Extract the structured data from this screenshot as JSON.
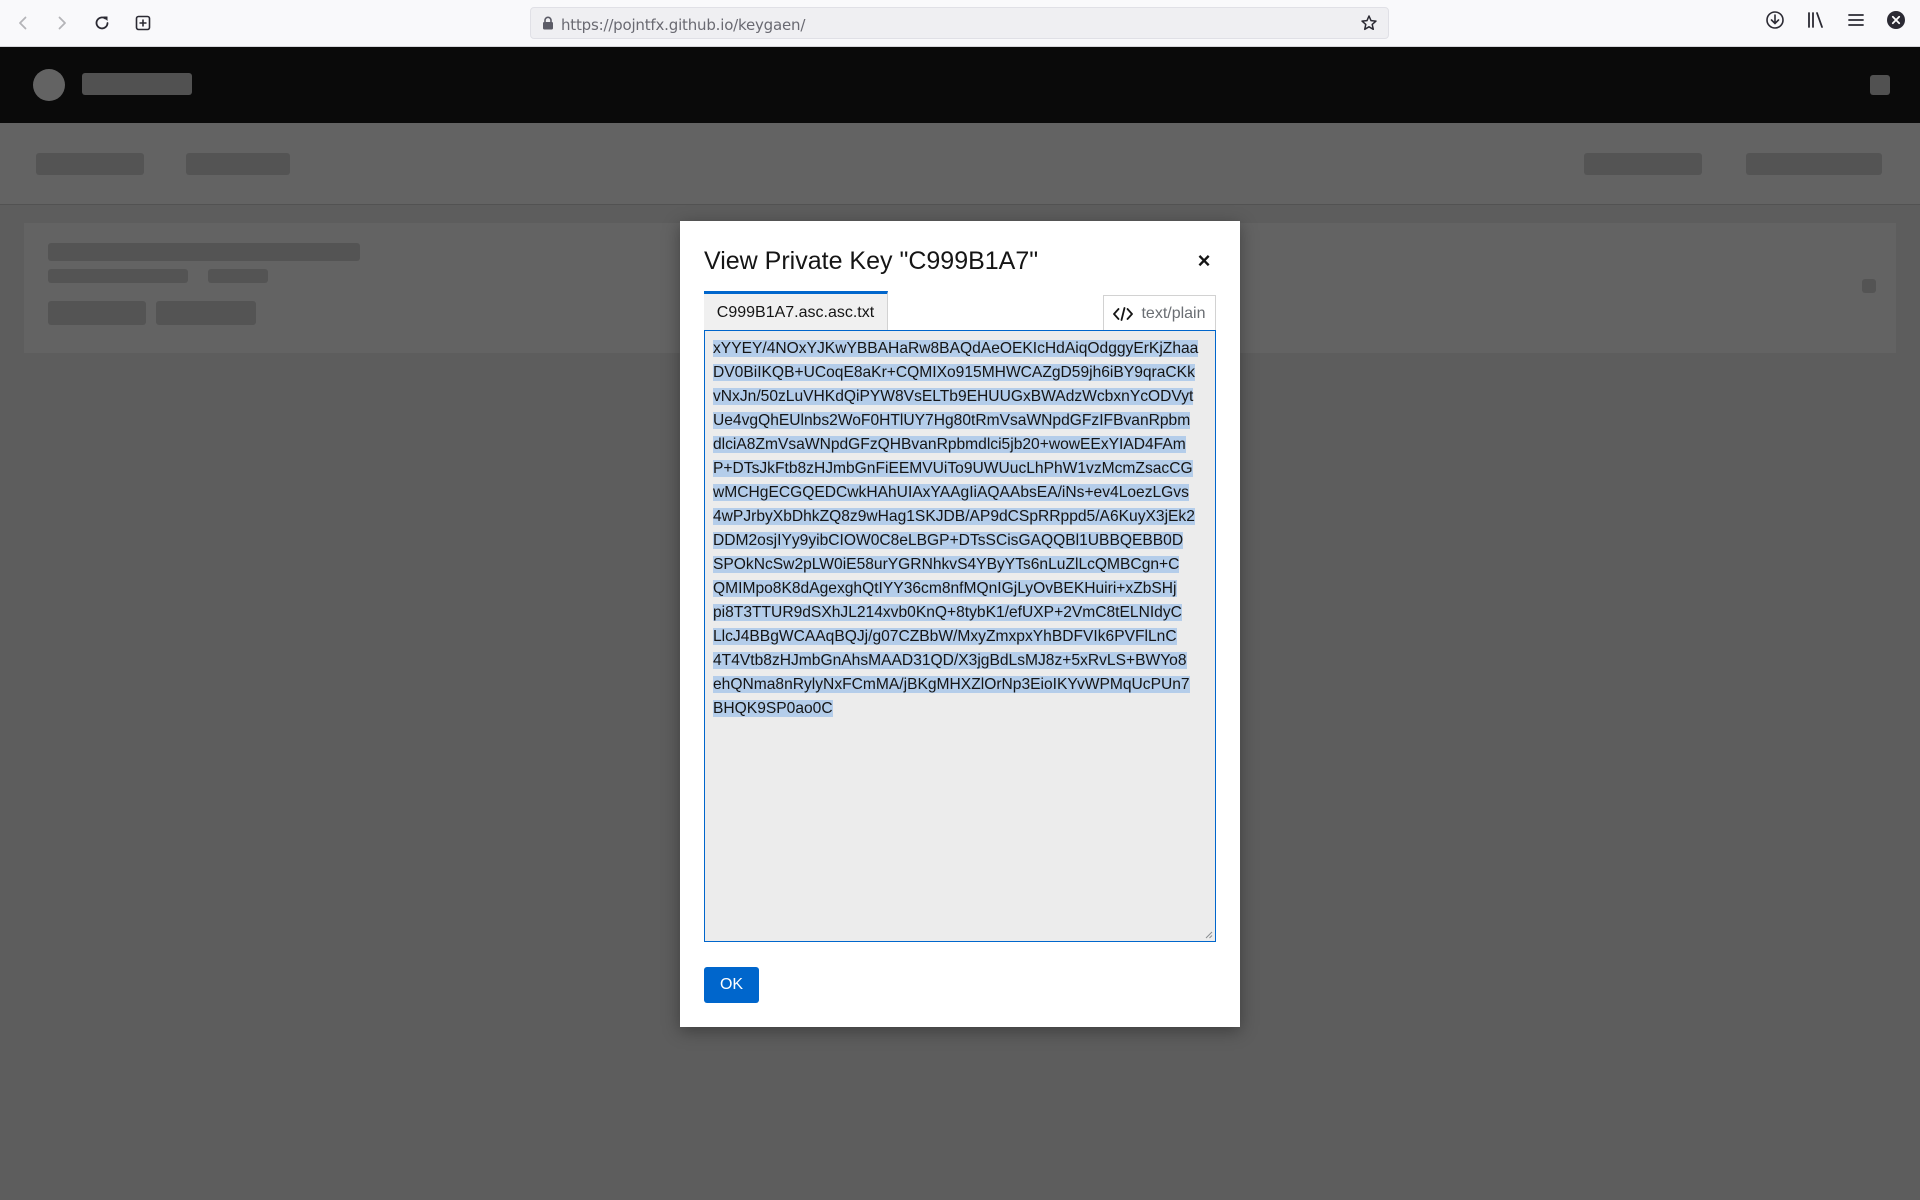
{
  "browser": {
    "url_host": "https://pojntfx.github.io",
    "url_path": "/keygaen/",
    "icons": [
      "back-icon",
      "forward-icon",
      "reload-icon",
      "new-tab-icon",
      "lock-icon",
      "star-icon",
      "download-icon",
      "library-icon",
      "menu-icon",
      "close-icon"
    ]
  },
  "modal": {
    "title": "View Private Key \"C999B1A7\"",
    "close_symbol": "×",
    "file_tab_label": "C999B1A7.asc.asc.txt",
    "mime_label": "text/plain",
    "ok_label": "OK",
    "key_lines": [
      "xYYEY/4NOxYJKwYBBAHaRw8BAQdAeOEKIcHdAiqOdggyErKjZhaa",
      "DV0BiIKQB+UCoqE8aKr+CQMIXo915MHWCAZgD59jh6iBY9qraCKk",
      "vNxJn/50zLuVHKdQiPYW8VsELTb9EHUUGxBWAdzWcbxnYcODVyt",
      "Ue4vgQhEUlnbs2WoF0HTlUY7Hg80tRmVsaWNpdGFzIFBvanRpbm",
      "dlciA8ZmVsaWNpdGFzQHBvanRpbmdlci5jb20+wowEExYIAD4FAm",
      "P+DTsJkFtb8zHJmbGnFiEEMVUiTo9UWUucLhPhW1vzMcmZsacCG",
      "wMCHgECGQEDCwkHAhUIAxYAAgIiAQAAbsEA/iNs+ev4LoezLGvs",
      "4wPJrbyXbDhkZQ8z9wHag1SKJDB/AP9dCSpRRppd5/A6KuyX3jEk2",
      "DDM2osjIYy9yibCIOW0C8eLBGP+DTsSCisGAQQBl1UBBQEBB0D",
      "SPOkNcSw2pLW0iE58urYGRNhkvS4YByYTs6nLuZlLcQMBCgn+C",
      "QMIMpo8K8dAgexghQtIYY36cm8nfMQnIGjLyOvBEKHuiri+xZbSHj",
      "pi8T3TTUR9dSXhJL214xvb0KnQ+8tybK1/efUXP+2VmC8tELNIdyC",
      "LlcJ4BBgWCAAqBQJj/g07CZBbW/MxyZmxpxYhBDFVIk6PVFlLnC",
      "4T4Vtb8zHJmbGnAhsMAAD31QD/X3jgBdLsMJ8z+5xRvLS+BWYo8",
      "ehQNma8nRylyNxFCmMA/jBKgMHXZlOrNp3EioIKYvWPMqUcPUn7",
      "BHQK9SP0ao0C"
    ]
  }
}
